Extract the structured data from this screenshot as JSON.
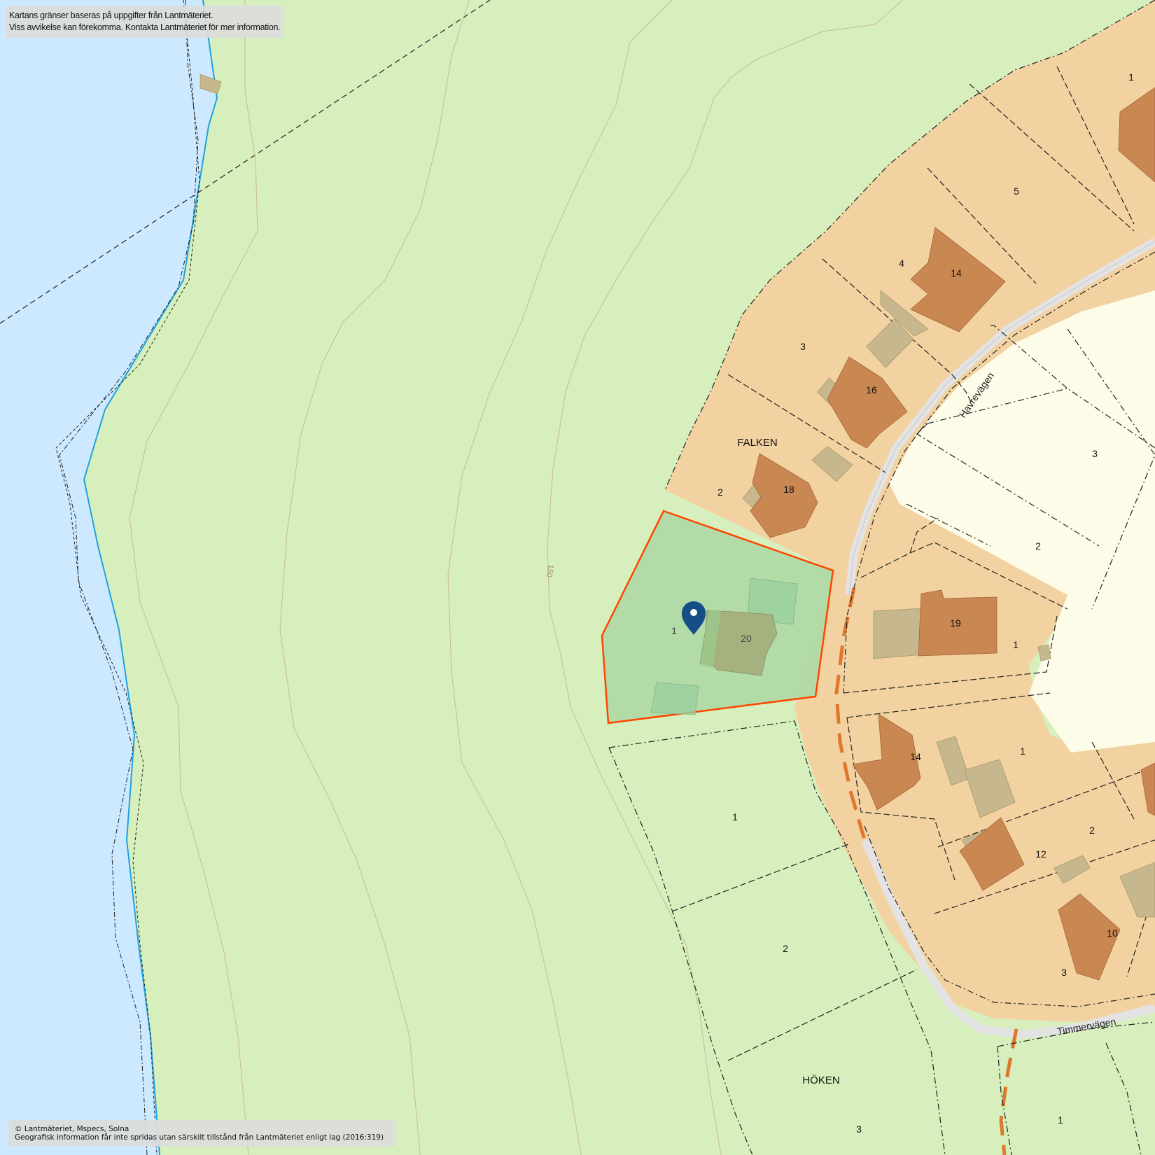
{
  "notices": {
    "top_line1": "Kartans gränser baseras på uppgifter från Lantmäteriet.",
    "top_line2": "Viss avvikelse kan förekomma. Kontakta Lantmäteriet för mer information.",
    "bottom_line1": "© Lantmäteriet, Mspecs, Solna",
    "bottom_line2": "Geografisk information får inte spridas utan särskilt tillstånd från Lantmäteriet enligt lag (2016:319)"
  },
  "block_names": {
    "falken": "FALKEN",
    "hoken": "HÖKEN"
  },
  "street_names": {
    "havrevagen": "Havrevägen",
    "timmervagen": "Timmervägen"
  },
  "contour_label": "150",
  "building_numbers": {
    "b14_top": "14",
    "b16": "16",
    "b18": "18",
    "b20": "20",
    "b19": "19",
    "b14_bottom": "14",
    "b12": "12",
    "b10": "10"
  },
  "parcel_numbers": {
    "falken_1_top": "1",
    "falken_5": "5",
    "falken_4": "4",
    "falken_3": "3",
    "falken_2": "2",
    "selected_1": "1",
    "east_3": "3",
    "east_2": "2",
    "east_1_mid": "1",
    "se_1": "1",
    "se_2": "2",
    "se_3": "3",
    "hoken_1": "1",
    "hoken_2": "2",
    "hoken_3": "3",
    "hoken_1_br": "1"
  },
  "colors": {
    "water": "#cde9ff",
    "land": "#d6efbc",
    "residential": "#f2d2a1",
    "building": "#c98752",
    "outbuilding": "#c7b78e",
    "yard": "#fdfce8",
    "selected_fill": "#b0d9a6",
    "selected_border": "#ff4500",
    "marker": "#164f87",
    "shoreline": "#1fa2e0",
    "path": "#e0772c",
    "road": "#e3e3e3"
  },
  "marker_icon": "map-pin-icon"
}
